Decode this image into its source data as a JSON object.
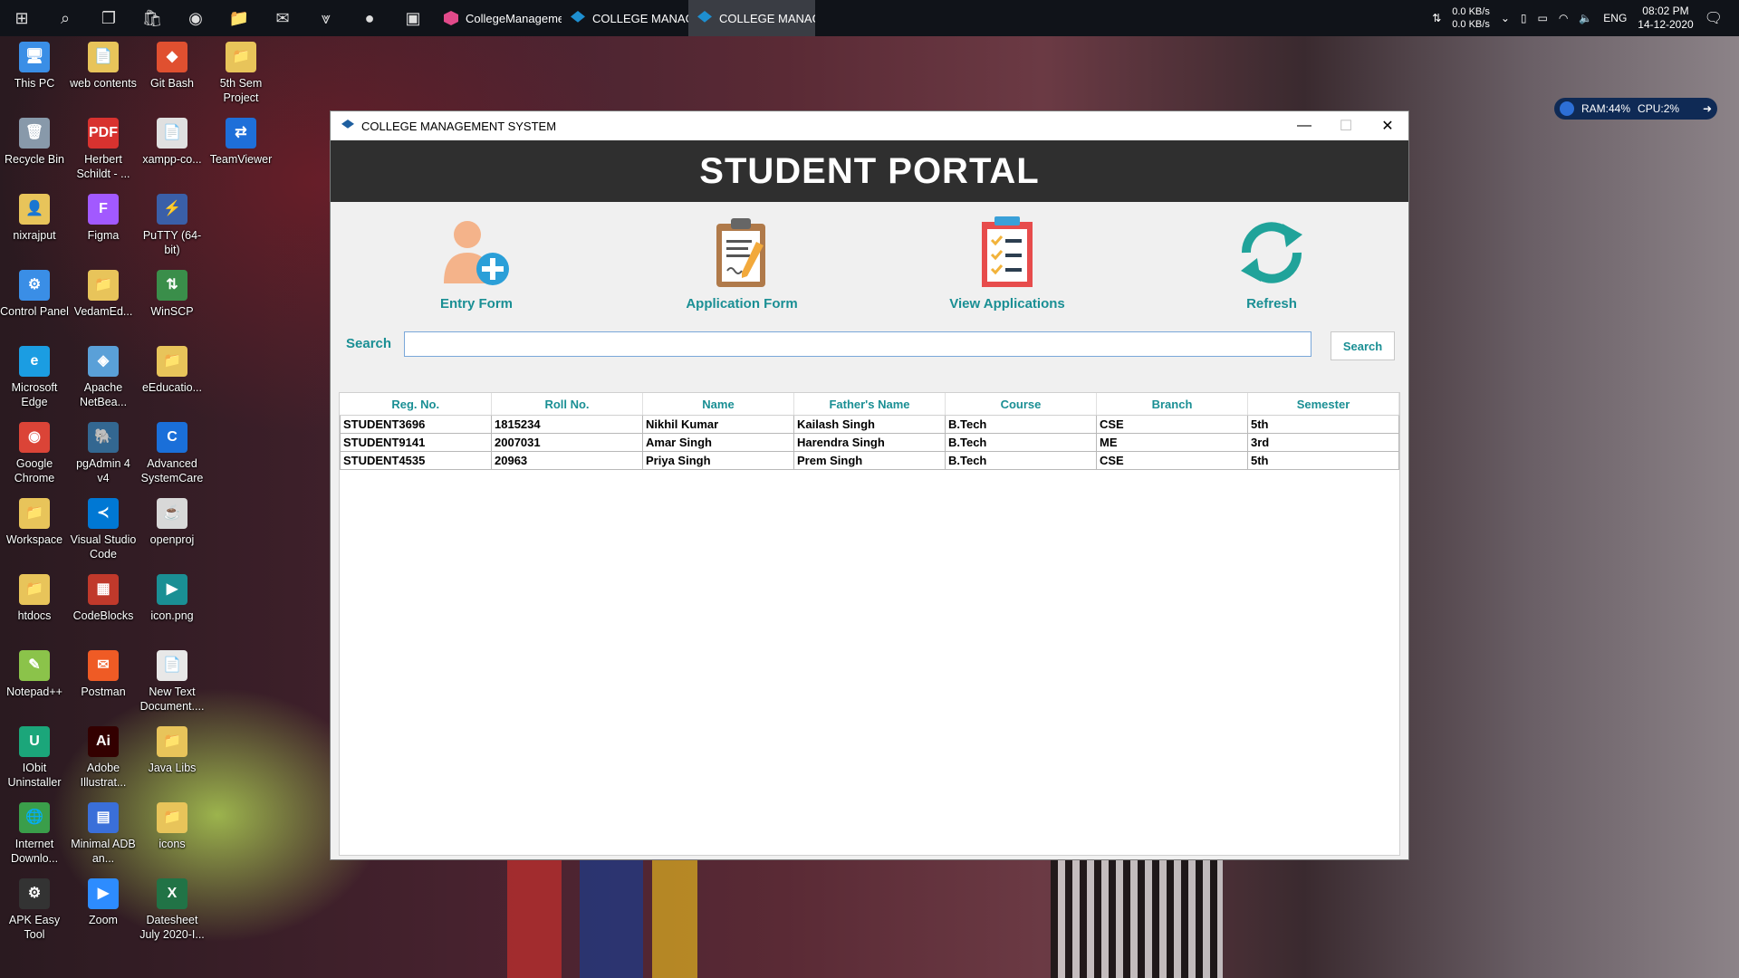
{
  "taskbar": {
    "apps": [
      {
        "label": "CollegeManageme...",
        "active": false
      },
      {
        "label": "COLLEGE MANAGE...",
        "active": false
      },
      {
        "label": "COLLEGE MANAGE...",
        "active": true
      }
    ],
    "net_down": "0.0 KB/s",
    "net_up": "0.0 KB/s",
    "lang": "ENG",
    "time": "08:02 PM",
    "date": "14-12-2020"
  },
  "desktop_icons": [
    {
      "label": "This PC",
      "col": 0,
      "row": 0,
      "color": "#3a8ee6",
      "glyph": "🖥"
    },
    {
      "label": "web contents",
      "col": 1,
      "row": 0,
      "color": "#e8c45a",
      "glyph": "📄"
    },
    {
      "label": "Git Bash",
      "col": 2,
      "row": 0,
      "color": "#e05030",
      "glyph": "◆"
    },
    {
      "label": "5th Sem Project",
      "col": 3,
      "row": 0,
      "color": "#e8c45a",
      "glyph": "📁"
    },
    {
      "label": "Recycle Bin",
      "col": 0,
      "row": 1,
      "color": "#8899aa",
      "glyph": "🗑"
    },
    {
      "label": "Herbert Schildt - ...",
      "col": 1,
      "row": 1,
      "color": "#d8322f",
      "glyph": "PDF"
    },
    {
      "label": "xampp-co...",
      "col": 2,
      "row": 1,
      "color": "#e0e0e0",
      "glyph": "📄"
    },
    {
      "label": "TeamViewer",
      "col": 3,
      "row": 1,
      "color": "#1e6fd9",
      "glyph": "⇄"
    },
    {
      "label": "nixrajput",
      "col": 0,
      "row": 2,
      "color": "#e8c45a",
      "glyph": "👤"
    },
    {
      "label": "Figma",
      "col": 1,
      "row": 2,
      "color": "#a259ff",
      "glyph": "F"
    },
    {
      "label": "PuTTY (64-bit)",
      "col": 2,
      "row": 2,
      "color": "#3a5fa8",
      "glyph": "⚡"
    },
    {
      "label": "Control Panel",
      "col": 0,
      "row": 3,
      "color": "#3a8ee6",
      "glyph": "⚙"
    },
    {
      "label": "VedamEd...",
      "col": 1,
      "row": 3,
      "color": "#e8c45a",
      "glyph": "📁"
    },
    {
      "label": "WinSCP",
      "col": 2,
      "row": 3,
      "color": "#3a8e4a",
      "glyph": "⇅"
    },
    {
      "label": "Microsoft Edge",
      "col": 0,
      "row": 4,
      "color": "#1b9de2",
      "glyph": "e"
    },
    {
      "label": "Apache NetBea...",
      "col": 1,
      "row": 4,
      "color": "#5aa0d8",
      "glyph": "◈"
    },
    {
      "label": "eEducatio...",
      "col": 2,
      "row": 4,
      "color": "#e8c45a",
      "glyph": "📁"
    },
    {
      "label": "Google Chrome",
      "col": 0,
      "row": 5,
      "color": "#db4437",
      "glyph": "◉"
    },
    {
      "label": "pgAdmin 4 v4",
      "col": 1,
      "row": 5,
      "color": "#336791",
      "glyph": "🐘"
    },
    {
      "label": "Advanced SystemCare",
      "col": 2,
      "row": 5,
      "color": "#1a6fd9",
      "glyph": "C"
    },
    {
      "label": "Workspace",
      "col": 0,
      "row": 6,
      "color": "#e8c45a",
      "glyph": "📁"
    },
    {
      "label": "Visual Studio Code",
      "col": 1,
      "row": 6,
      "color": "#0078d4",
      "glyph": "≺"
    },
    {
      "label": "openproj",
      "col": 2,
      "row": 6,
      "color": "#d8d8d8",
      "glyph": "☕"
    },
    {
      "label": "htdocs",
      "col": 0,
      "row": 7,
      "color": "#e8c45a",
      "glyph": "📁"
    },
    {
      "label": "CodeBlocks",
      "col": 1,
      "row": 7,
      "color": "#c0392b",
      "glyph": "▦"
    },
    {
      "label": "icon.png",
      "col": 2,
      "row": 7,
      "color": "#1a8f94",
      "glyph": "▶"
    },
    {
      "label": "Notepad++",
      "col": 0,
      "row": 8,
      "color": "#8bc34a",
      "glyph": "✎"
    },
    {
      "label": "Postman",
      "col": 1,
      "row": 8,
      "color": "#ef5b25",
      "glyph": "✉"
    },
    {
      "label": "New Text Document....",
      "col": 2,
      "row": 8,
      "color": "#e8e8e8",
      "glyph": "📄"
    },
    {
      "label": "IObit Uninstaller",
      "col": 0,
      "row": 9,
      "color": "#1ba67a",
      "glyph": "U"
    },
    {
      "label": "Adobe Illustrat...",
      "col": 1,
      "row": 9,
      "color": "#330000",
      "glyph": "Ai"
    },
    {
      "label": "Java Libs",
      "col": 2,
      "row": 9,
      "color": "#e8c45a",
      "glyph": "📁"
    },
    {
      "label": "Internet Downlo...",
      "col": 0,
      "row": 10,
      "color": "#3a9e4a",
      "glyph": "🌐"
    },
    {
      "label": "Minimal ADB an...",
      "col": 1,
      "row": 10,
      "color": "#3a6fd9",
      "glyph": "▤"
    },
    {
      "label": "icons",
      "col": 2,
      "row": 10,
      "color": "#e8c45a",
      "glyph": "📁"
    },
    {
      "label": "APK Easy Tool",
      "col": 0,
      "row": 11,
      "color": "#333333",
      "glyph": "⚙"
    },
    {
      "label": "Zoom",
      "col": 1,
      "row": 11,
      "color": "#2d8cff",
      "glyph": "▶"
    },
    {
      "label": "Datesheet July 2020-I...",
      "col": 2,
      "row": 11,
      "color": "#217346",
      "glyph": "X"
    }
  ],
  "widget": {
    "ram": "RAM:44%",
    "cpu": "CPU:2%"
  },
  "window": {
    "title": "COLLEGE MANAGEMENT SYSTEM",
    "header": "STUDENT PORTAL",
    "tools": [
      {
        "label": "Entry Form",
        "icon": "add-user-icon"
      },
      {
        "label": "Application Form",
        "icon": "clipboard-pen-icon"
      },
      {
        "label": "View Applications",
        "icon": "checklist-icon"
      },
      {
        "label": "Refresh",
        "icon": "refresh-icon"
      }
    ],
    "search": {
      "label": "Search",
      "value": "",
      "button": "Search"
    },
    "table": {
      "columns": [
        "Reg. No.",
        "Roll No.",
        "Name",
        "Father's Name",
        "Course",
        "Branch",
        "Semester"
      ],
      "rows": [
        [
          "STUDENT3696",
          "1815234",
          "Nikhil Kumar",
          "Kailash Singh",
          "B.Tech",
          "CSE",
          "5th"
        ],
        [
          "STUDENT9141",
          "2007031",
          "Amar Singh",
          "Harendra Singh",
          "B.Tech",
          "ME",
          "3rd"
        ],
        [
          "STUDENT4535",
          "20963",
          "Priya Singh",
          "Prem Singh",
          "B.Tech",
          "CSE",
          "5th"
        ]
      ]
    }
  }
}
